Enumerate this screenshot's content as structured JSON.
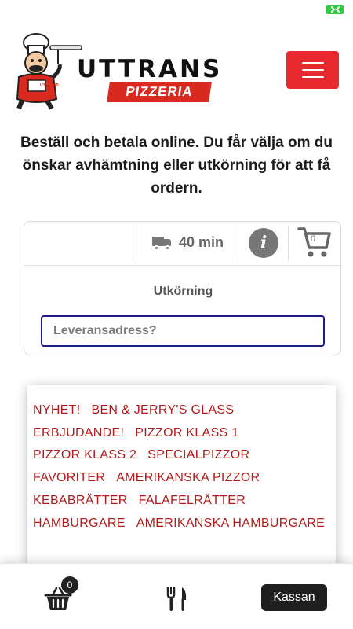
{
  "brand": {
    "name_top": "UTTRANS",
    "name_bottom": "PIZZERIA",
    "apron_text": "UTTRANS",
    "accent_color": "#e82a2f",
    "category_color": "#b31b1b"
  },
  "header": {
    "menu_icon": "hamburger-menu-icon"
  },
  "intro_text": "Beställ och betala online. Du får välja om du önskar avhämtning eller utkörning för att få ordern.",
  "order": {
    "delivery_time": "40 min",
    "truck_icon": "truck-icon",
    "info_icon_glyph": "i",
    "cart_count": "0",
    "delivery_mode": "Utkörning",
    "address_placeholder": "Leveransadress?",
    "address_value": ""
  },
  "categories": [
    "NYHET!",
    "BEN & JERRY'S GLASS",
    "ERBJUDANDE!",
    "PIZZOR KLASS 1",
    "PIZZOR KLASS 2",
    "SPECIALPIZZOR",
    "FAVORITER",
    "AMERIKANSKA PIZZOR",
    "KEBABRÄTTER",
    "FALAFELRÄTTER",
    "HAMBURGARE",
    "AMERIKANSKA HAMBURGARE"
  ],
  "bottom_bar": {
    "basket_count": "0",
    "basket_icon": "basket-icon",
    "cutlery_icon": "cutlery-icon",
    "checkout_label": "Kassan"
  }
}
